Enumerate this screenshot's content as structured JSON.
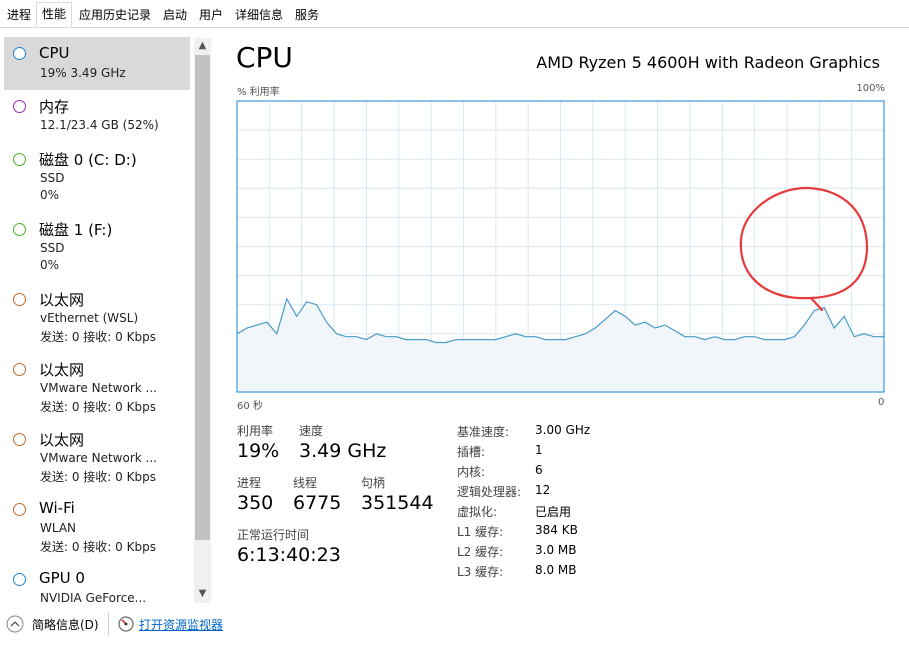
{
  "tabs": [
    "进程",
    "性能",
    "应用历史记录",
    "启动",
    "用户",
    "详细信息",
    "服务"
  ],
  "active_tab": "性能",
  "sidebar": {
    "items": [
      {
        "title": "CPU",
        "sub1": "19%  3.49 GHz",
        "sub2": "",
        "color": "#1a83d4"
      },
      {
        "title": "内存",
        "sub1": "12.1/23.4 GB (52%)",
        "sub2": "",
        "color": "#9b2ab7"
      },
      {
        "title": "磁盘 0 (C: D:)",
        "sub1": "SSD",
        "sub2": "0%",
        "color": "#4caf25"
      },
      {
        "title": "磁盘 1 (F:)",
        "sub1": "SSD",
        "sub2": "0%",
        "color": "#4caf25"
      },
      {
        "title": "以太网",
        "sub1": "vEthernet (WSL)",
        "sub2": "发送: 0 接收: 0 Kbps",
        "color": "#c56a2a"
      },
      {
        "title": "以太网",
        "sub1": "VMware Network ...",
        "sub2": "发送: 0 接收: 0 Kbps",
        "color": "#c56a2a"
      },
      {
        "title": "以太网",
        "sub1": "VMware Network ...",
        "sub2": "发送: 0 接收: 0 Kbps",
        "color": "#c56a2a"
      },
      {
        "title": "Wi-Fi",
        "sub1": "WLAN",
        "sub2": "发送: 0 接收: 0 Kbps",
        "color": "#c56a2a"
      },
      {
        "title": "GPU 0",
        "sub1": "NVIDIA GeForce...",
        "sub2": "",
        "color": "#1a83d4"
      }
    ]
  },
  "main": {
    "title": "CPU",
    "model": "AMD Ryzen 5 4600H with Radeon Graphics",
    "graph_ylabel": "% 利用率",
    "graph_ymax": "100%",
    "graph_xleft": "60 秒",
    "graph_xright": "0",
    "utilization_label": "利用率",
    "utilization": "19%",
    "speed_label": "速度",
    "speed": "3.49 GHz",
    "processes_label": "进程",
    "processes": "350",
    "threads_label": "线程",
    "threads": "6775",
    "handles_label": "句柄",
    "handles": "351544",
    "uptime_label": "正常运行时间",
    "uptime": "6:13:40:23",
    "specs": [
      {
        "k": "基准速度:",
        "v": "3.00 GHz"
      },
      {
        "k": "插槽:",
        "v": "1"
      },
      {
        "k": "内核:",
        "v": "6"
      },
      {
        "k": "逻辑处理器:",
        "v": "12"
      },
      {
        "k": "虚拟化:",
        "v": "已启用"
      },
      {
        "k": "L1 缓存:",
        "v": "384 KB"
      },
      {
        "k": "L2 缓存:",
        "v": "3.0 MB"
      },
      {
        "k": "L3 缓存:",
        "v": "8.0 MB"
      }
    ]
  },
  "chart_data": {
    "type": "area",
    "ylabel": "% 利用率",
    "ylim": [
      0,
      100
    ],
    "x_left_label": "60 秒",
    "x_right_label": "0",
    "values": [
      20,
      22,
      23,
      24,
      20,
      32,
      26,
      31,
      30,
      24,
      20,
      19,
      19,
      18,
      20,
      19,
      19,
      18,
      18,
      18,
      17,
      17,
      18,
      18,
      18,
      18,
      18,
      19,
      20,
      19,
      19,
      18,
      18,
      18,
      19,
      20,
      22,
      25,
      28,
      26,
      23,
      24,
      22,
      23,
      21,
      19,
      19,
      18,
      19,
      18,
      18,
      19,
      19,
      18,
      18,
      18,
      19,
      23,
      28,
      29,
      22,
      26,
      19,
      20,
      19,
      19
    ],
    "grid": true,
    "annotation": "red freehand circle around recent spike"
  },
  "bottom": {
    "summary_label": "简略信息(D)",
    "monitor_link": "打开资源监视器"
  },
  "colors": {
    "graph_line": "#4a9bc8",
    "graph_fill": "#f1f6fb",
    "graph_grid": "#d9e8f2",
    "graph_border": "#1a83d4",
    "annotation": "#e53b3b"
  }
}
